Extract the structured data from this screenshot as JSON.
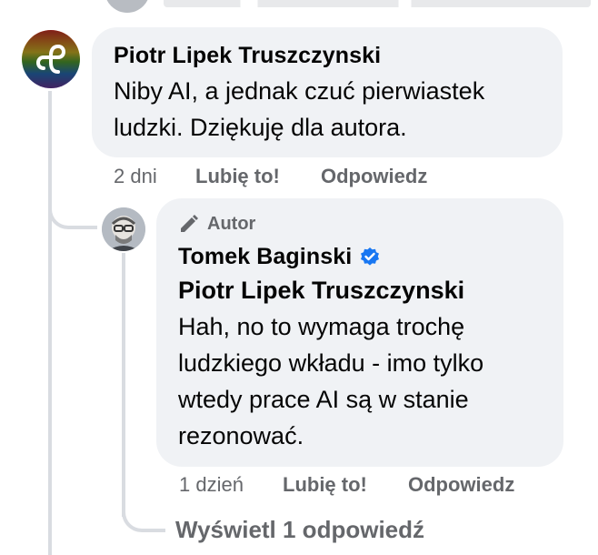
{
  "comment": {
    "author": "Piotr Lipek Truszczynski",
    "text_line1": "Niby AI, a jednak czuć pierwiastek",
    "text_line2": "ludzki. Dziękuję dla autora.",
    "time": "2 dni",
    "like": "Lubię to!",
    "reply": "Odpowiedz"
  },
  "reply": {
    "badge": "Autor",
    "author": "Tomek Baginski",
    "mention": "Piotr Lipek Truszczynski",
    "text_line1": "Hah, no to wymaga trochę",
    "text_line2": "ludzkiego wkładu - imo tylko",
    "text_line3": "wtedy prace AI są w stanie",
    "text_line4": "rezonować.",
    "time": "1 dzień",
    "like": "Lubię to!",
    "reply": "Odpowiedz"
  },
  "view_replies": "Wyświetl 1 odpowiedź",
  "colors": {
    "bubble": "#f0f2f5",
    "meta": "#65676b",
    "verified": "#1877f2",
    "thread_line": "#d9dce1"
  },
  "icons": [
    "app-logo-icon",
    "pencil-icon",
    "verified-badge-icon",
    "user-avatar"
  ]
}
